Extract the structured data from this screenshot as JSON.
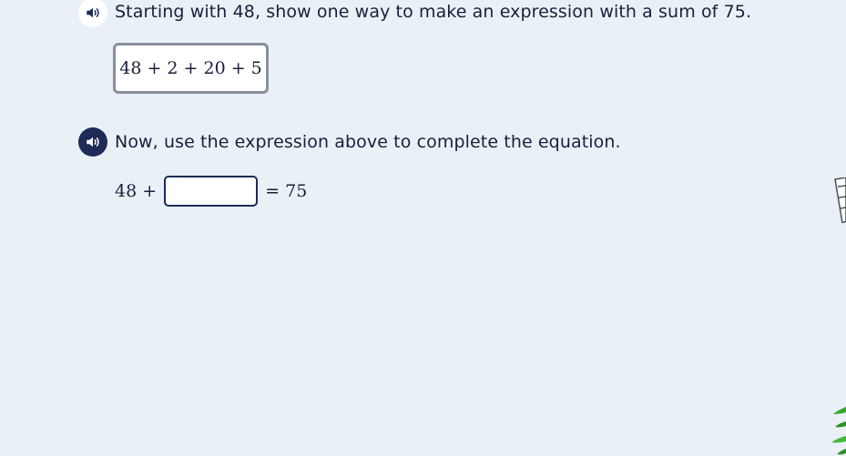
{
  "question_1": {
    "audio_icon": "speaker-icon",
    "prompt_text": "Starting with 48, show one way to make an expression with a sum of 75.",
    "expression": "48 + 2 + 20 + 5"
  },
  "question_2": {
    "audio_icon": "speaker-icon",
    "prompt_text": "Now, use the expression above to complete the equation.",
    "equation": {
      "left_term": "48 +",
      "input_value": "",
      "right_side": "= 75"
    }
  },
  "colors": {
    "background": "#e9f1f7",
    "text": "#1b1f3a",
    "accent_dark": "#1e2b57",
    "card_border": "#8a8f9c"
  }
}
